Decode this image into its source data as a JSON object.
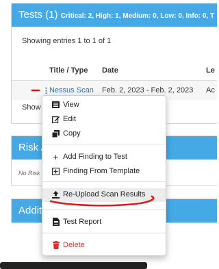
{
  "tests": {
    "heading": "Tests (1)",
    "summary": "Critical: 2, High: 1, Medium: 0, Low: 0, Info: 0, T",
    "showing": "Showing entries 1 to 1 of 1",
    "columns": [
      "Title / Type",
      "Date",
      "Le"
    ],
    "row": {
      "actions": "⋮",
      "title": "Nessus Scan",
      "date": "Feb. 2, 2023 - Feb. 2, 2023",
      "extra": "Ac"
    },
    "show_label": "Show"
  },
  "risk": {
    "heading": "Risk A",
    "body": "No Risk"
  },
  "additional": {
    "heading": "Additi"
  },
  "menu": {
    "view": "View",
    "edit": "Edit",
    "copy": "Copy",
    "add_finding": "Add Finding to Test",
    "finding_template": "Finding From Template",
    "reupload": "Re-Upload Scan Results",
    "report": "Test Report",
    "delete": "Delete"
  },
  "colors": {
    "heading": "#44a9e4",
    "link": "#2a6db0",
    "danger": "#d9322c",
    "annotation": "#e0191c"
  }
}
